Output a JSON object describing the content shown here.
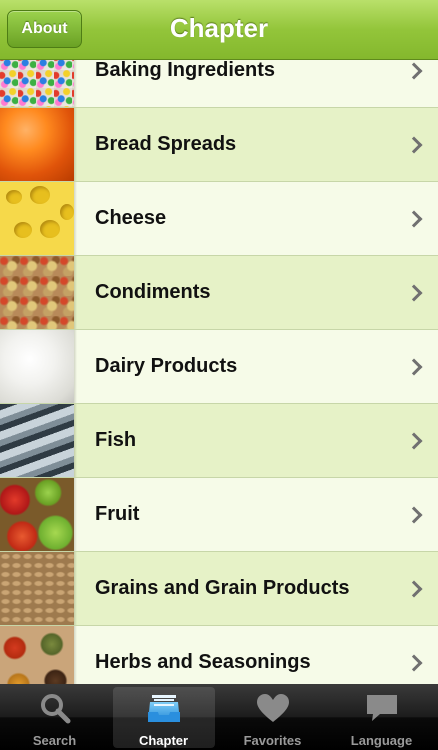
{
  "navbar": {
    "title": "Chapter",
    "about_label": "About"
  },
  "chapters": [
    {
      "label": "Baking Ingredients",
      "thumb": "sprinkles"
    },
    {
      "label": "Bread Spreads",
      "thumb": "jam"
    },
    {
      "label": "Cheese",
      "thumb": "swiss-cheese"
    },
    {
      "label": "Condiments",
      "thumb": "relish"
    },
    {
      "label": "Dairy Products",
      "thumb": "cream"
    },
    {
      "label": "Fish",
      "thumb": "sardines"
    },
    {
      "label": "Fruit",
      "thumb": "apples"
    },
    {
      "label": "Grains and Grain Products",
      "thumb": "grains"
    },
    {
      "label": "Herbs and Seasonings",
      "thumb": "spices"
    }
  ],
  "tabbar": {
    "tabs": [
      {
        "label": "Search",
        "icon": "search-icon"
      },
      {
        "label": "Chapter",
        "icon": "inbox-tray-icon",
        "selected": true
      },
      {
        "label": "Favorites",
        "icon": "heart-icon"
      },
      {
        "label": "Language",
        "icon": "speech-bubble-icon"
      }
    ]
  },
  "colors": {
    "nav_green": "#93c53a",
    "row_alt": "#e6f2c7",
    "row_norm": "#f6fbe8",
    "tab_selected_icon": "#3aa0e0"
  }
}
